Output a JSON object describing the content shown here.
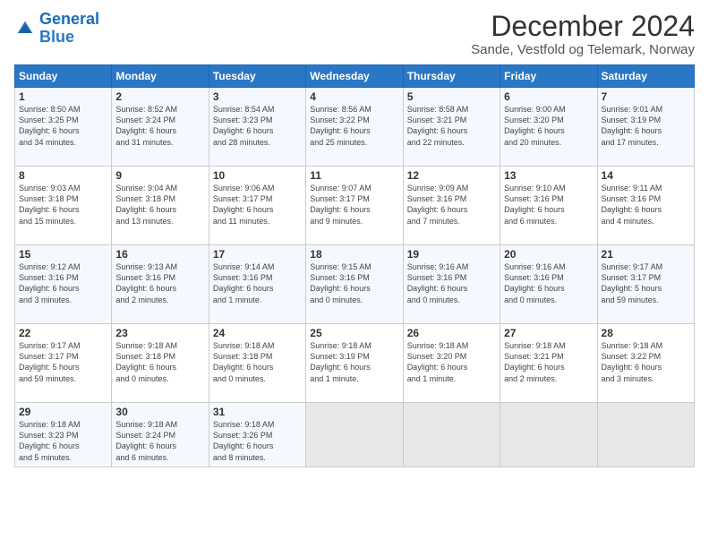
{
  "header": {
    "logo_line1": "General",
    "logo_line2": "Blue",
    "title": "December 2024",
    "subtitle": "Sande, Vestfold og Telemark, Norway"
  },
  "days_header": [
    "Sunday",
    "Monday",
    "Tuesday",
    "Wednesday",
    "Thursday",
    "Friday",
    "Saturday"
  ],
  "weeks": [
    [
      {
        "day": "1",
        "lines": [
          "Sunrise: 8:50 AM",
          "Sunset: 3:25 PM",
          "Daylight: 6 hours",
          "and 34 minutes."
        ]
      },
      {
        "day": "2",
        "lines": [
          "Sunrise: 8:52 AM",
          "Sunset: 3:24 PM",
          "Daylight: 6 hours",
          "and 31 minutes."
        ]
      },
      {
        "day": "3",
        "lines": [
          "Sunrise: 8:54 AM",
          "Sunset: 3:23 PM",
          "Daylight: 6 hours",
          "and 28 minutes."
        ]
      },
      {
        "day": "4",
        "lines": [
          "Sunrise: 8:56 AM",
          "Sunset: 3:22 PM",
          "Daylight: 6 hours",
          "and 25 minutes."
        ]
      },
      {
        "day": "5",
        "lines": [
          "Sunrise: 8:58 AM",
          "Sunset: 3:21 PM",
          "Daylight: 6 hours",
          "and 22 minutes."
        ]
      },
      {
        "day": "6",
        "lines": [
          "Sunrise: 9:00 AM",
          "Sunset: 3:20 PM",
          "Daylight: 6 hours",
          "and 20 minutes."
        ]
      },
      {
        "day": "7",
        "lines": [
          "Sunrise: 9:01 AM",
          "Sunset: 3:19 PM",
          "Daylight: 6 hours",
          "and 17 minutes."
        ]
      }
    ],
    [
      {
        "day": "8",
        "lines": [
          "Sunrise: 9:03 AM",
          "Sunset: 3:18 PM",
          "Daylight: 6 hours",
          "and 15 minutes."
        ]
      },
      {
        "day": "9",
        "lines": [
          "Sunrise: 9:04 AM",
          "Sunset: 3:18 PM",
          "Daylight: 6 hours",
          "and 13 minutes."
        ]
      },
      {
        "day": "10",
        "lines": [
          "Sunrise: 9:06 AM",
          "Sunset: 3:17 PM",
          "Daylight: 6 hours",
          "and 11 minutes."
        ]
      },
      {
        "day": "11",
        "lines": [
          "Sunrise: 9:07 AM",
          "Sunset: 3:17 PM",
          "Daylight: 6 hours",
          "and 9 minutes."
        ]
      },
      {
        "day": "12",
        "lines": [
          "Sunrise: 9:09 AM",
          "Sunset: 3:16 PM",
          "Daylight: 6 hours",
          "and 7 minutes."
        ]
      },
      {
        "day": "13",
        "lines": [
          "Sunrise: 9:10 AM",
          "Sunset: 3:16 PM",
          "Daylight: 6 hours",
          "and 6 minutes."
        ]
      },
      {
        "day": "14",
        "lines": [
          "Sunrise: 9:11 AM",
          "Sunset: 3:16 PM",
          "Daylight: 6 hours",
          "and 4 minutes."
        ]
      }
    ],
    [
      {
        "day": "15",
        "lines": [
          "Sunrise: 9:12 AM",
          "Sunset: 3:16 PM",
          "Daylight: 6 hours",
          "and 3 minutes."
        ]
      },
      {
        "day": "16",
        "lines": [
          "Sunrise: 9:13 AM",
          "Sunset: 3:16 PM",
          "Daylight: 6 hours",
          "and 2 minutes."
        ]
      },
      {
        "day": "17",
        "lines": [
          "Sunrise: 9:14 AM",
          "Sunset: 3:16 PM",
          "Daylight: 6 hours",
          "and 1 minute."
        ]
      },
      {
        "day": "18",
        "lines": [
          "Sunrise: 9:15 AM",
          "Sunset: 3:16 PM",
          "Daylight: 6 hours",
          "and 0 minutes."
        ]
      },
      {
        "day": "19",
        "lines": [
          "Sunrise: 9:16 AM",
          "Sunset: 3:16 PM",
          "Daylight: 6 hours",
          "and 0 minutes."
        ]
      },
      {
        "day": "20",
        "lines": [
          "Sunrise: 9:16 AM",
          "Sunset: 3:16 PM",
          "Daylight: 6 hours",
          "and 0 minutes."
        ]
      },
      {
        "day": "21",
        "lines": [
          "Sunrise: 9:17 AM",
          "Sunset: 3:17 PM",
          "Daylight: 5 hours",
          "and 59 minutes."
        ]
      }
    ],
    [
      {
        "day": "22",
        "lines": [
          "Sunrise: 9:17 AM",
          "Sunset: 3:17 PM",
          "Daylight: 5 hours",
          "and 59 minutes."
        ]
      },
      {
        "day": "23",
        "lines": [
          "Sunrise: 9:18 AM",
          "Sunset: 3:18 PM",
          "Daylight: 6 hours",
          "and 0 minutes."
        ]
      },
      {
        "day": "24",
        "lines": [
          "Sunrise: 9:18 AM",
          "Sunset: 3:18 PM",
          "Daylight: 6 hours",
          "and 0 minutes."
        ]
      },
      {
        "day": "25",
        "lines": [
          "Sunrise: 9:18 AM",
          "Sunset: 3:19 PM",
          "Daylight: 6 hours",
          "and 1 minute."
        ]
      },
      {
        "day": "26",
        "lines": [
          "Sunrise: 9:18 AM",
          "Sunset: 3:20 PM",
          "Daylight: 6 hours",
          "and 1 minute."
        ]
      },
      {
        "day": "27",
        "lines": [
          "Sunrise: 9:18 AM",
          "Sunset: 3:21 PM",
          "Daylight: 6 hours",
          "and 2 minutes."
        ]
      },
      {
        "day": "28",
        "lines": [
          "Sunrise: 9:18 AM",
          "Sunset: 3:22 PM",
          "Daylight: 6 hours",
          "and 3 minutes."
        ]
      }
    ],
    [
      {
        "day": "29",
        "lines": [
          "Sunrise: 9:18 AM",
          "Sunset: 3:23 PM",
          "Daylight: 6 hours",
          "and 5 minutes."
        ]
      },
      {
        "day": "30",
        "lines": [
          "Sunrise: 9:18 AM",
          "Sunset: 3:24 PM",
          "Daylight: 6 hours",
          "and 6 minutes."
        ]
      },
      {
        "day": "31",
        "lines": [
          "Sunrise: 9:18 AM",
          "Sunset: 3:26 PM",
          "Daylight: 6 hours",
          "and 8 minutes."
        ]
      },
      null,
      null,
      null,
      null
    ]
  ]
}
